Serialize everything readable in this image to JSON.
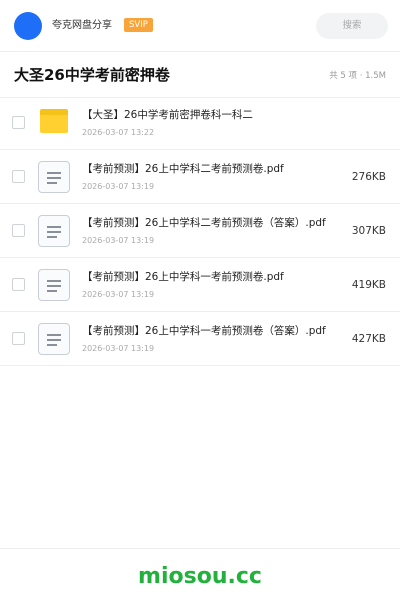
{
  "header": {
    "app_name": "夸克网盘分享",
    "badge": "SVIP",
    "search_placeholder": "搜索",
    "avatar_color": "#1f6ef7",
    "badge_color": "#f7a53b"
  },
  "share": {
    "title": "大圣26中学考前密押卷",
    "summary": "共 5 项 · 1.5M"
  },
  "files": [
    {
      "type": "folder",
      "icon": "folder-icon",
      "name": "【大圣】26中学考前密押卷科一科二",
      "date": "2026-03-07 13:22",
      "size": ""
    },
    {
      "type": "document",
      "icon": "document-icon",
      "name": "【考前预测】26上中学科二考前预测卷.pdf",
      "date": "2026-03-07 13:19",
      "size": "276KB"
    },
    {
      "type": "document",
      "icon": "document-icon",
      "name": "【考前预测】26上中学科二考前预测卷（答案）.pdf",
      "date": "2026-03-07 13:19",
      "size": "307KB"
    },
    {
      "type": "document",
      "icon": "document-icon",
      "name": "【考前预测】26上中学科一考前预测卷.pdf",
      "date": "2026-03-07 13:19",
      "size": "419KB"
    },
    {
      "type": "document",
      "icon": "document-icon",
      "name": "【考前预测】26上中学科一考前预测卷（答案）.pdf",
      "date": "2026-03-07 13:19",
      "size": "427KB"
    }
  ],
  "footer": {
    "watermark": "miosou.cc",
    "watermark_color": "#22b13a"
  }
}
